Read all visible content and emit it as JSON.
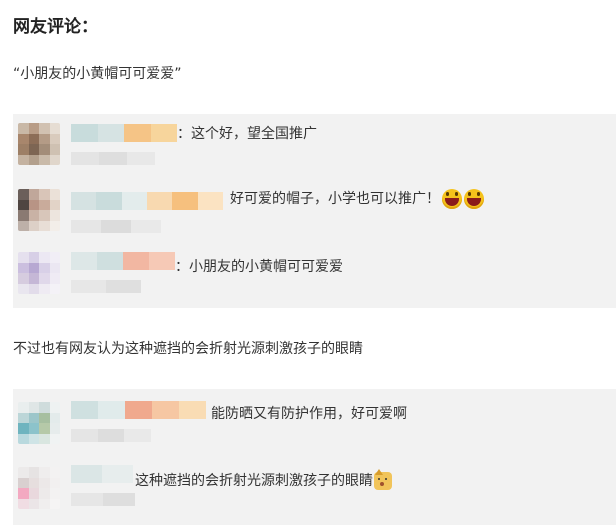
{
  "heading": "网友评论：",
  "quote": "“小朋友的小黄帽可可爱爱”",
  "paragraph": "不过也有网友认为这种遮挡的会折射光源刺激孩子的眼睛",
  "panel1": {
    "comments": [
      {
        "text": "：这个好，望全国推广",
        "emojis": []
      },
      {
        "text": "好可爱的帽子，小学也可以推广！",
        "emojis": [
          "grin-emoji",
          "grin-emoji"
        ]
      },
      {
        "text": "：小朋友的小黄帽可可爱爱",
        "emojis": []
      }
    ]
  },
  "panel2": {
    "comments": [
      {
        "text": "能防晒又有防护作用，好可爱啊",
        "emojis": []
      },
      {
        "text": "这种遮挡的会折射光源刺激孩子的眼睛",
        "emojis": [
          "doge-emoji"
        ]
      }
    ]
  }
}
